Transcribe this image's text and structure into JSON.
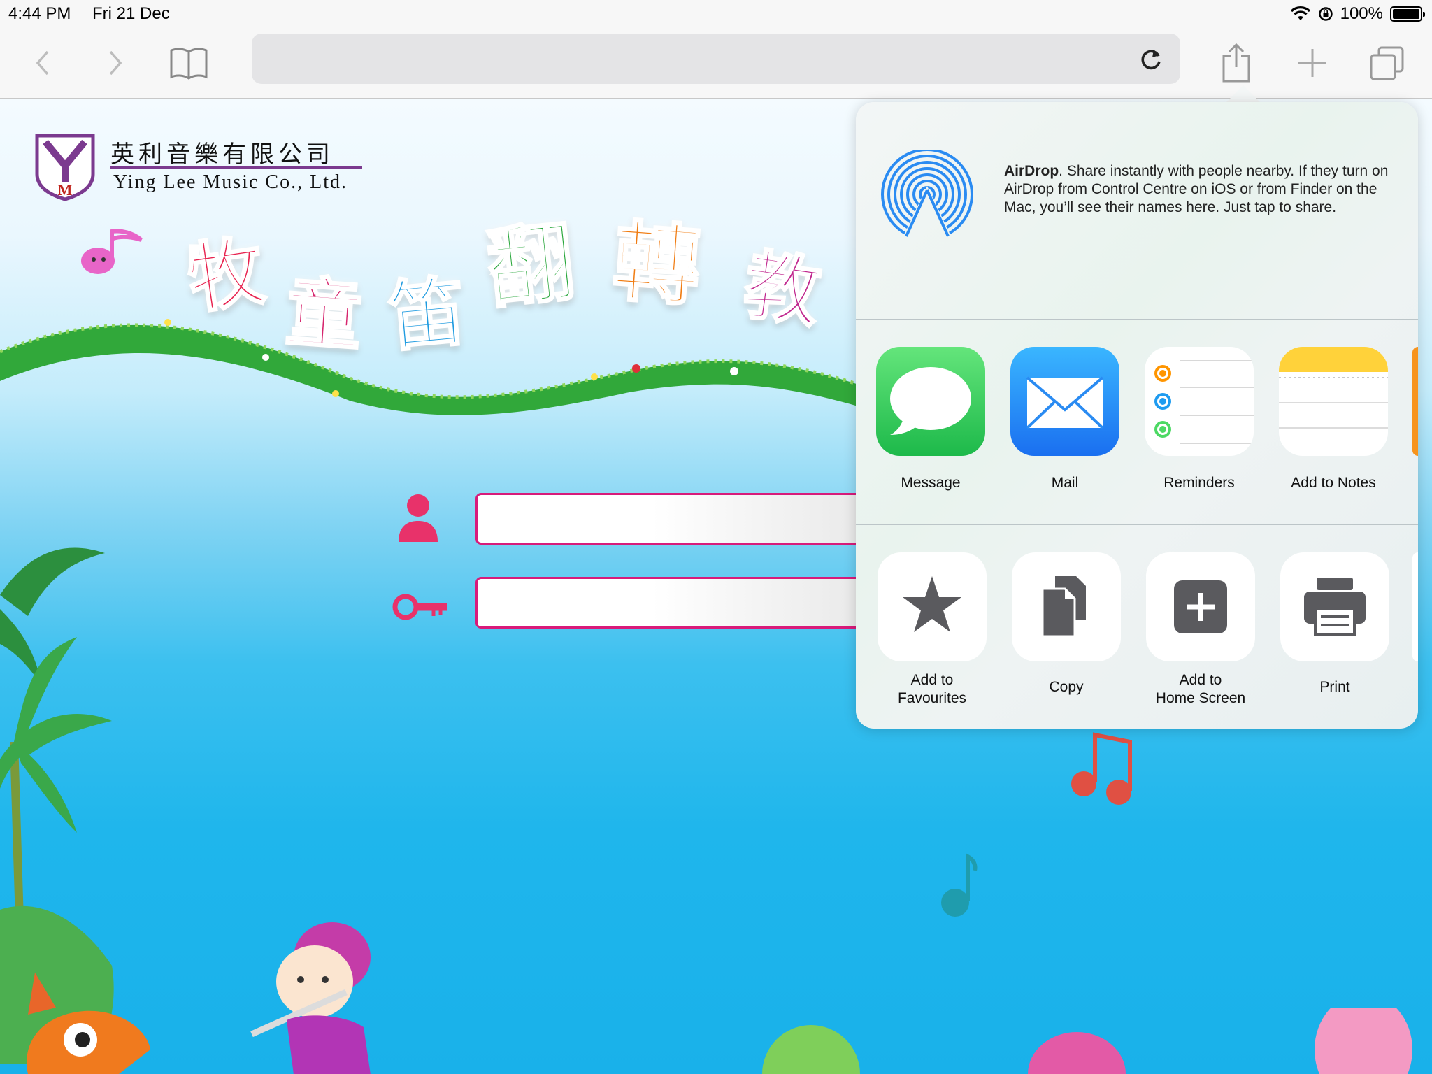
{
  "status_bar": {
    "time": "4:44 PM",
    "date": "Fri 21 Dec",
    "battery": "100%"
  },
  "toolbar": {
    "url_text": "",
    "icons": [
      "back-icon",
      "forward-icon",
      "bookmarks-icon",
      "reload-icon",
      "share-icon",
      "new-tab-icon",
      "tabs-icon"
    ]
  },
  "page": {
    "company_cn": "英利音樂有限公司",
    "company_en": "Ying Lee Music Co., Ltd.",
    "logo_letters": "YM",
    "title_chars": [
      "牧",
      "童",
      "笛",
      "翻",
      "轉",
      "教"
    ],
    "title_colors": [
      "#e8234f",
      "#d6266e",
      "#1f9be0",
      "#27a63a",
      "#f07c12",
      "#c0278e"
    ],
    "username_value": "",
    "password_value": ""
  },
  "share_sheet": {
    "airdrop": {
      "title": "AirDrop",
      "description": ". Share instantly with people nearby. If they turn on AirDrop from Control Centre on iOS or from Finder on the Mac, you’ll see their names here. Just tap to share."
    },
    "apps": [
      {
        "label": "Message"
      },
      {
        "label": "Mail"
      },
      {
        "label": "Reminders"
      },
      {
        "label": "Add to Notes"
      }
    ],
    "actions": [
      {
        "line1": "Add to",
        "line2": "Favourites"
      },
      {
        "line1": "Copy",
        "line2": ""
      },
      {
        "line1": "Add to",
        "line2": "Home Screen"
      },
      {
        "line1": "Print",
        "line2": ""
      }
    ],
    "colors": {
      "messages": "#2fd158",
      "mail": "#1e8ff5",
      "notes": "#ffd23a",
      "action_glyph": "#5a5a5e",
      "airdrop": "#2a8bf2"
    }
  }
}
